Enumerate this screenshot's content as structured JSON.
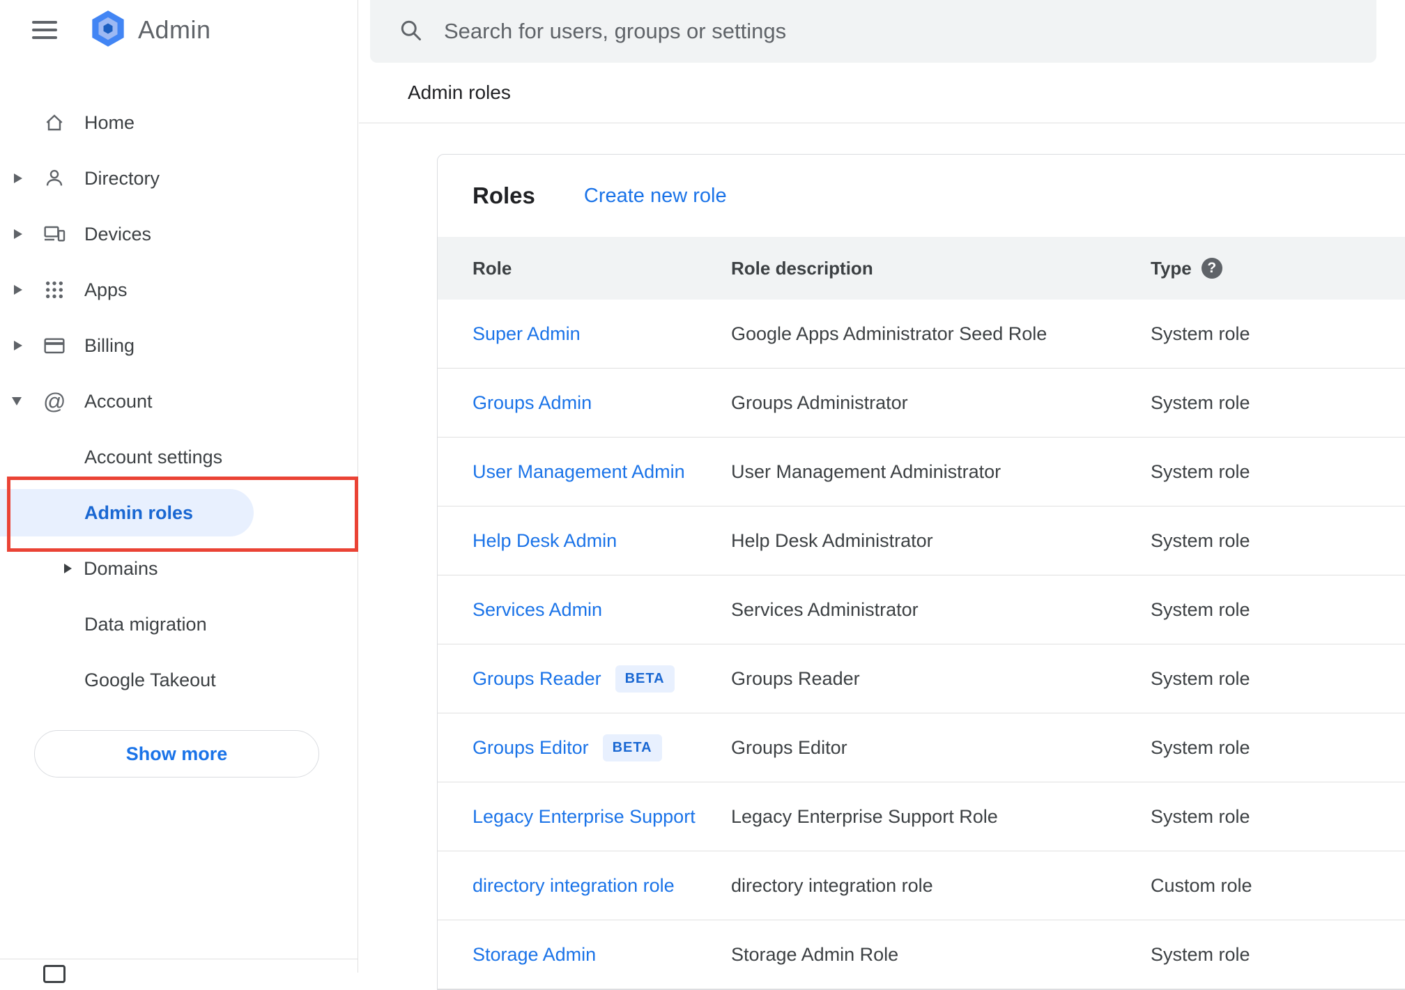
{
  "window": {
    "title": "Admin"
  },
  "search": {
    "placeholder": "Search for users, groups or settings",
    "icon": "search-icon"
  },
  "breadcrumb": {
    "label": "Admin roles"
  },
  "sidebar": {
    "brand": {
      "logo_icon": "admin-hexagon-logo",
      "title": "Admin"
    },
    "menu_icon": "hamburger-menu-icon",
    "items": [
      {
        "label": "Home",
        "icon": "home-icon",
        "expandable": false
      },
      {
        "label": "Directory",
        "icon": "person-icon",
        "expandable": true
      },
      {
        "label": "Devices",
        "icon": "devices-icon",
        "expandable": true
      },
      {
        "label": "Apps",
        "icon": "apps-grid-icon",
        "expandable": true
      },
      {
        "label": "Billing",
        "icon": "credit-card-icon",
        "expandable": true
      },
      {
        "label": "Account",
        "icon": "at-sign-icon",
        "expandable": true,
        "expanded": true
      }
    ],
    "account_children": [
      {
        "label": "Account settings",
        "active": false
      },
      {
        "label": "Admin roles",
        "active": true
      },
      {
        "label": "Domains",
        "expandable": true
      },
      {
        "label": "Data migration"
      },
      {
        "label": "Google Takeout"
      }
    ],
    "show_more_label": "Show more"
  },
  "annotation": {
    "shape": "red-rectangle",
    "color": "#ea4335",
    "target": "Admin roles"
  },
  "roles": {
    "title": "Roles",
    "create_link_label": "Create new role",
    "columns": {
      "role": "Role",
      "description": "Role description",
      "type": "Type"
    },
    "help_icon": "question-mark-help-icon",
    "rows": [
      {
        "role": "Super Admin",
        "description": "Google Apps Administrator Seed Role",
        "type": "System role"
      },
      {
        "role": "Groups Admin",
        "description": "Groups Administrator",
        "type": "System role"
      },
      {
        "role": "User Management Admin",
        "description": "User Management Administrator",
        "type": "System role"
      },
      {
        "role": "Help Desk Admin",
        "description": "Help Desk Administrator",
        "type": "System role"
      },
      {
        "role": "Services Admin",
        "description": "Services Administrator",
        "type": "System role"
      },
      {
        "role": "Groups Reader",
        "badge": "BETA",
        "description": "Groups Reader",
        "type": "System role"
      },
      {
        "role": "Groups Editor",
        "badge": "BETA",
        "description": "Groups Editor",
        "type": "System role"
      },
      {
        "role": "Legacy Enterprise Support",
        "description": "Legacy Enterprise Support Role",
        "type": "System role"
      },
      {
        "role": "directory integration role",
        "description": "directory integration role",
        "type": "Custom role"
      },
      {
        "role": "Storage Admin",
        "description": "Storage Admin Role",
        "type": "System role"
      }
    ]
  },
  "colors": {
    "link_blue": "#1a73e8",
    "active_blue": "#1967d2",
    "active_pill_bg": "#e8f0fe",
    "annotation_red": "#ea4335",
    "table_header_bg": "#f1f3f4",
    "search_bg": "#f1f3f4"
  }
}
